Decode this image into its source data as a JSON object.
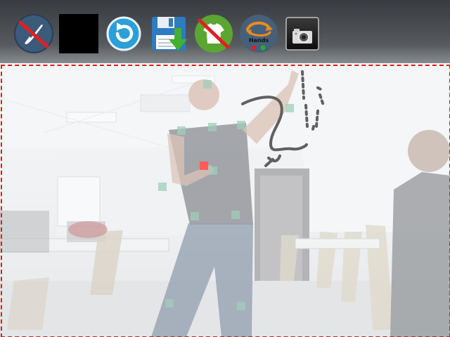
{
  "toolbar": {
    "tools": [
      {
        "id": "brush-disabled",
        "icon": "brush-crossed-icon",
        "color": "#3c5a7a"
      },
      {
        "id": "color-swatch",
        "icon": "black-swatch",
        "color": "#000000"
      },
      {
        "id": "undo",
        "icon": "undo-arrow-icon",
        "color": "#2a9fd8"
      },
      {
        "id": "save",
        "icon": "floppy-download-icon",
        "color": "#2e7bbf"
      },
      {
        "id": "shirt-disabled",
        "icon": "shirt-crossed-icon",
        "color": "#5aa631"
      },
      {
        "id": "hands",
        "icon": "hands-toggle-icon",
        "label": "Hands",
        "color": "#46607a"
      },
      {
        "id": "camera",
        "icon": "camera-icon",
        "color": "#222222"
      }
    ]
  },
  "capture_region": {
    "border_color": "#e01818"
  }
}
